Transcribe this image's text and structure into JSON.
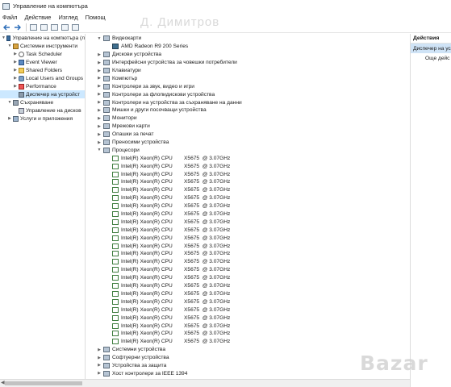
{
  "window": {
    "title": "Управление на компютъра"
  },
  "menu": [
    "Файл",
    "Действие",
    "Изглед",
    "Помощ"
  ],
  "watermark_top": "Д. Димитров",
  "left_tree": [
    {
      "label": "Управление на компютъра (л",
      "level": 0,
      "expanded": true,
      "icon": "computer-management-icon",
      "selected": false
    },
    {
      "label": "Системни инструменти",
      "level": 1,
      "expanded": true,
      "icon": "system-tools-icon",
      "selected": false
    },
    {
      "label": "Task Scheduler",
      "level": 2,
      "expanded": false,
      "icon": "clock-icon",
      "selected": false
    },
    {
      "label": "Event Viewer",
      "level": 2,
      "expanded": false,
      "icon": "event-viewer-icon",
      "selected": false
    },
    {
      "label": "Shared Folders",
      "level": 2,
      "expanded": false,
      "icon": "folder-icon",
      "selected": false
    },
    {
      "label": "Local Users and Groups",
      "level": 2,
      "expanded": false,
      "icon": "users-icon",
      "selected": false
    },
    {
      "label": "Performance",
      "level": 2,
      "expanded": false,
      "icon": "performance-icon",
      "selected": false
    },
    {
      "label": "Диспечер на устройст",
      "level": 2,
      "expanded": null,
      "icon": "device-manager-icon",
      "selected": true
    },
    {
      "label": "Съхраняване",
      "level": 1,
      "expanded": true,
      "icon": "storage-icon",
      "selected": false
    },
    {
      "label": "Управление на дисков",
      "level": 2,
      "expanded": null,
      "icon": "disk-icon",
      "selected": false
    },
    {
      "label": "Услуги и приложения",
      "level": 1,
      "expanded": false,
      "icon": "services-icon",
      "selected": false
    }
  ],
  "devices": {
    "top_categories": [
      {
        "label": "Видеокарти",
        "expanded": true,
        "icon": "display-adapter-icon"
      }
    ],
    "gpu": "AMD Radeon R9 200 Series",
    "middle_categories": [
      "Дискови устройства",
      "Интерфейсни устройства за човешки потребители",
      "Клавиатури",
      "Компютър",
      "Контролери за звук, видео и игри",
      "Контролери за флопидискови устройства",
      "Контролери на устройства за съхраняване на данни",
      "Мишки и други посочващи устройства",
      "Монитори",
      "Мрежови карти",
      "Опашки за печат",
      "Преносими устройства"
    ],
    "processors_label": "Процесори",
    "cpu_name": "Intel(R) Xeon(R) CPU",
    "cpu_model": "X5675  @ 3.07GHz",
    "cpu_count": 24,
    "bottom_categories": [
      "Системни устройства",
      "Софтуерни устройства",
      "Устройства за защита",
      "Хост контролери за IEEE 1394"
    ]
  },
  "actions": {
    "header": "Действия",
    "sub": "Диспечер на ус",
    "more": "Още дейс"
  },
  "watermark_bottom": "Bazar"
}
